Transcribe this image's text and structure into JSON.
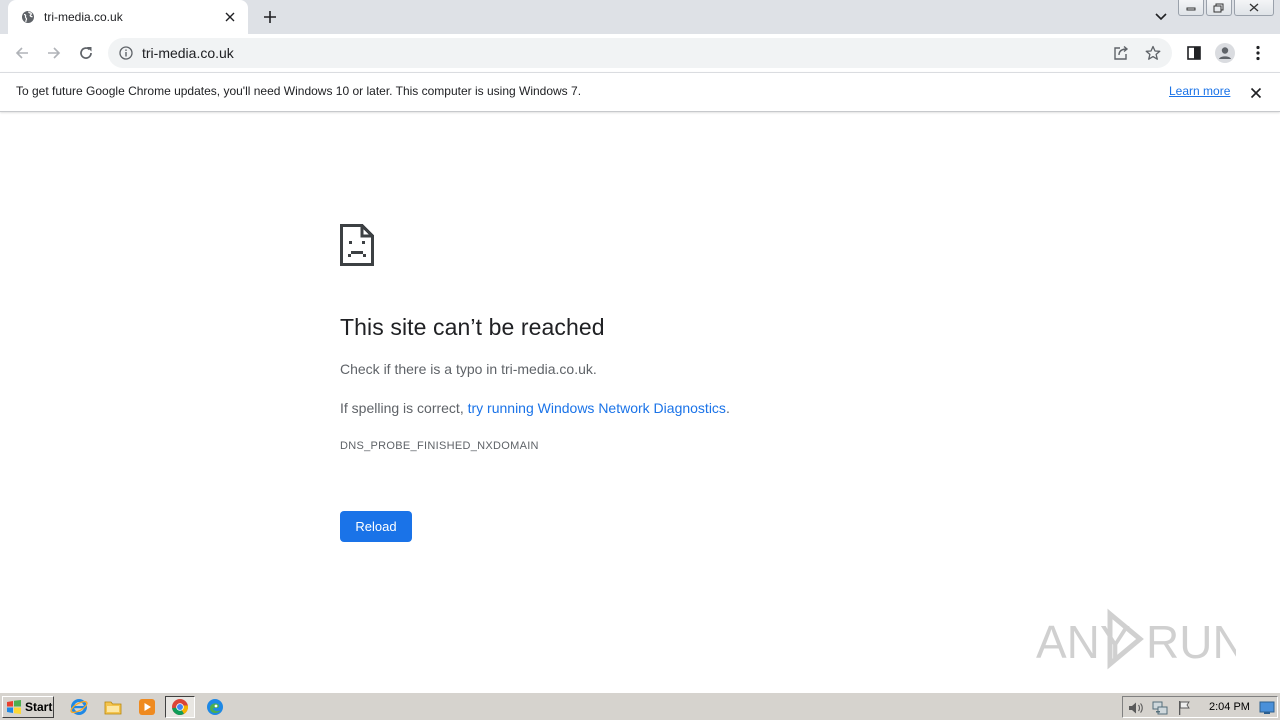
{
  "browser": {
    "tab": {
      "title": "tri-media.co.uk"
    },
    "address": {
      "url": "tri-media.co.uk"
    }
  },
  "infobar": {
    "message": "To get future Google Chrome updates, you'll need Windows 10 or later. This computer is using Windows 7.",
    "link_label": "Learn more"
  },
  "error_page": {
    "title": "This site can’t be reached",
    "line1": "Check if there is a typo in tri-media.co.uk.",
    "line2_prefix": "If spelling is correct, ",
    "line2_link": "try running Windows Network Diagnostics",
    "line2_suffix": ".",
    "error_code": "DNS_PROBE_FINISHED_NXDOMAIN",
    "reload_label": "Reload"
  },
  "watermark": {
    "text": "ANY RUN"
  },
  "taskbar": {
    "start_label": "Start",
    "clock": "2:04 PM"
  },
  "colors": {
    "accent": "#1a73e8",
    "tabstrip": "#dee1e6",
    "omnibox": "#f1f3f4",
    "taskbar": "#d6d3ce"
  },
  "icons": {
    "tab_favicon": "globe-icon",
    "tab_close": "close-icon",
    "new_tab": "plus-icon",
    "tab_search": "chevron-down-icon",
    "back": "arrow-left-icon",
    "forward": "arrow-right-icon",
    "reload": "reload-icon",
    "site_info": "info-icon",
    "share": "share-icon",
    "bookmark": "star-icon",
    "side_panel": "side-panel-icon",
    "profile": "profile-icon",
    "menu": "kebab-menu-icon",
    "error": "sad-document-icon"
  }
}
